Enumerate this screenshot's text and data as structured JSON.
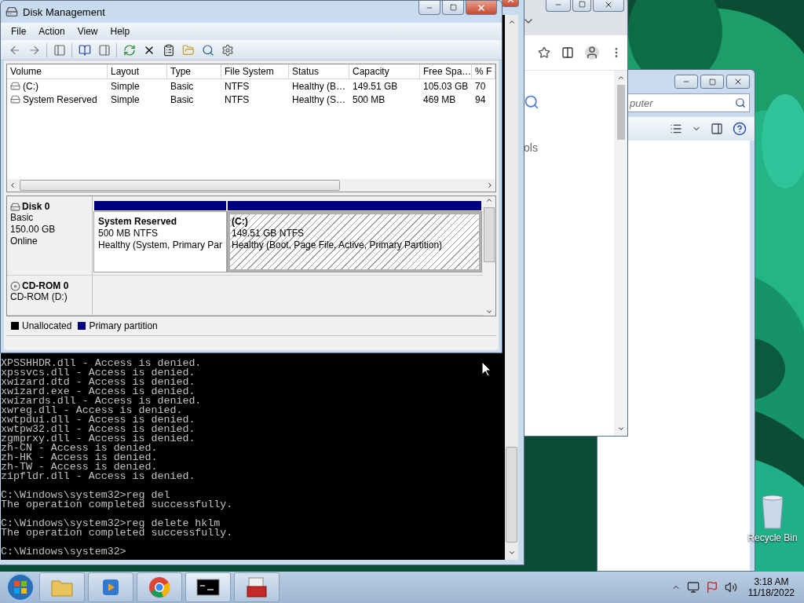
{
  "disk_management": {
    "title": "Disk Management",
    "menu": [
      "File",
      "Action",
      "View",
      "Help"
    ],
    "columns": [
      "Volume",
      "Layout",
      "Type",
      "File System",
      "Status",
      "Capacity",
      "Free Spa…",
      "% F"
    ],
    "rows": [
      {
        "cells": [
          "(C:)",
          "Simple",
          "Basic",
          "NTFS",
          "Healthy (B…",
          "149.51 GB",
          "105.03 GB",
          "70"
        ]
      },
      {
        "cells": [
          "System Reserved",
          "Simple",
          "Basic",
          "NTFS",
          "Healthy (S…",
          "500 MB",
          "469 MB",
          "94"
        ]
      }
    ],
    "disks": [
      {
        "kind": "disk",
        "name": "Disk 0",
        "details": [
          "Basic",
          "150.00 GB",
          "Online"
        ],
        "partitions": [
          {
            "name": "System Reserved",
            "size": "500 MB NTFS",
            "status": "Healthy (System, Primary Par",
            "selected": false
          },
          {
            "name": "(C:)",
            "size": "149.51 GB NTFS",
            "status": "Healthy (Boot, Page File, Active, Primary Partition)",
            "selected": true
          }
        ]
      },
      {
        "kind": "cdrom",
        "name": "CD-ROM 0",
        "details": [
          "CD-ROM (D:)"
        ]
      }
    ],
    "legend": [
      {
        "label": "Unallocated",
        "color": "#000000"
      },
      {
        "label": "Primary partition",
        "color": "#000080"
      }
    ]
  },
  "console": {
    "blocks": [
      {
        "lines": [
          "XPSSHHDR.dll - Access is denied.",
          "xpssvcs.dll - Access is denied.",
          "xwizard.dtd - Access is denied.",
          "xwizard.exe - Access is denied.",
          "xwizards.dll - Access is denied.",
          "xwreg.dll - Access is denied.",
          "xwtpdui.dll - Access is denied.",
          "xwtpw32.dll - Access is denied.",
          "zgmprxy.dll - Access is denied.",
          "zh-CN - Access is denied.",
          "zh-HK - Access is denied.",
          "zh-TW - Access is denied.",
          "zipfldr.dll - Access is denied."
        ]
      },
      {
        "lines": [
          "C:\\Windows\\system32>reg del",
          "The operation completed successfully."
        ]
      },
      {
        "lines": [
          "C:\\Windows\\system32>reg delete hklm",
          "The operation completed successfully."
        ]
      },
      {
        "lines": [
          "C:\\Windows\\system32>"
        ]
      }
    ]
  },
  "browser": {
    "fragment": "ols"
  },
  "explorer": {
    "placeholder": "puter"
  },
  "desktop_icons": [
    {
      "label": "Recycle Bin"
    }
  ],
  "taskbar": {
    "time": "3:18 AM",
    "date": "11/18/2022"
  }
}
